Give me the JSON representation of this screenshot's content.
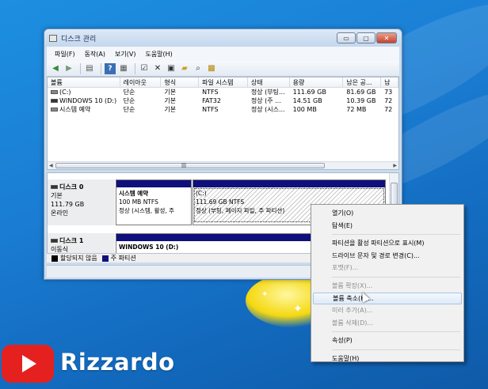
{
  "window": {
    "title": "디스크 관리",
    "controls": {
      "minimize": "▭",
      "maximize": "▢",
      "close": "✕"
    }
  },
  "menu": [
    "파일(F)",
    "동작(A)",
    "보기(V)",
    "도움말(H)"
  ],
  "toolbar_icons": [
    "back-icon",
    "forward-icon",
    "console-icon",
    "help-icon",
    "properties-icon",
    "delete-icon",
    "settings-icon",
    "open-icon",
    "search-icon",
    "rescan-icon"
  ],
  "volume_list": {
    "headers": [
      "볼륨",
      "레이아웃",
      "형식",
      "파일 시스템",
      "상태",
      "용량",
      "남은 공...",
      "남"
    ],
    "rows": [
      [
        "(C:)",
        "단순",
        "기본",
        "NTFS",
        "정상 (부팅...",
        "111.69 GB",
        "81.69 GB",
        "73"
      ],
      [
        "WINDOWS 10 (D:)",
        "단순",
        "기본",
        "FAT32",
        "정상 (주 ...",
        "14.51 GB",
        "10.39 GB",
        "72"
      ],
      [
        "시스템 예약",
        "단순",
        "기본",
        "NTFS",
        "정상 (시스...",
        "100 MB",
        "72 MB",
        "72"
      ]
    ]
  },
  "disks": [
    {
      "name": "디스크 0",
      "type": "기본",
      "size": "111.79 GB",
      "status": "온라인",
      "volumes": [
        {
          "name": "시스템 예약",
          "size": "100 MB NTFS",
          "status": "정상 (시스템, 활성, 주"
        },
        {
          "name": "(C:)",
          "size": "111.69 GB NTFS",
          "status": "정상 (부팅, 페이지 파일, 주 파티션)"
        }
      ]
    },
    {
      "name": "디스크 1",
      "type": "이동식",
      "volumes": [
        {
          "name": "WINDOWS 10  (D:)"
        }
      ]
    }
  ],
  "legend": [
    {
      "label": "할당되지 않음",
      "color": "#000000"
    },
    {
      "label": "주 파티션",
      "color": "#10107c"
    }
  ],
  "context_menu": [
    {
      "label": "열기(O)",
      "enabled": true
    },
    {
      "label": "탐색(E)",
      "enabled": true
    },
    {
      "sep": true
    },
    {
      "label": "파티션을 활성 파티션으로 표시(M)",
      "enabled": true
    },
    {
      "label": "드라이브 문자 및 경로 변경(C)...",
      "enabled": true
    },
    {
      "label": "포맷(F)...",
      "enabled": false
    },
    {
      "sep": true
    },
    {
      "label": "볼륨 확장(X)...",
      "enabled": false
    },
    {
      "label": "볼륨 축소(H)...",
      "enabled": true,
      "hover": true
    },
    {
      "label": "미러 추가(A)...",
      "enabled": false
    },
    {
      "label": "볼륨 삭제(D)...",
      "enabled": false
    },
    {
      "sep": true
    },
    {
      "label": "속성(P)",
      "enabled": true
    },
    {
      "sep": true
    },
    {
      "label": "도움말(H)",
      "enabled": true
    }
  ],
  "brand": {
    "name": "Rizzardo",
    "logo_color": "#e5211f"
  }
}
